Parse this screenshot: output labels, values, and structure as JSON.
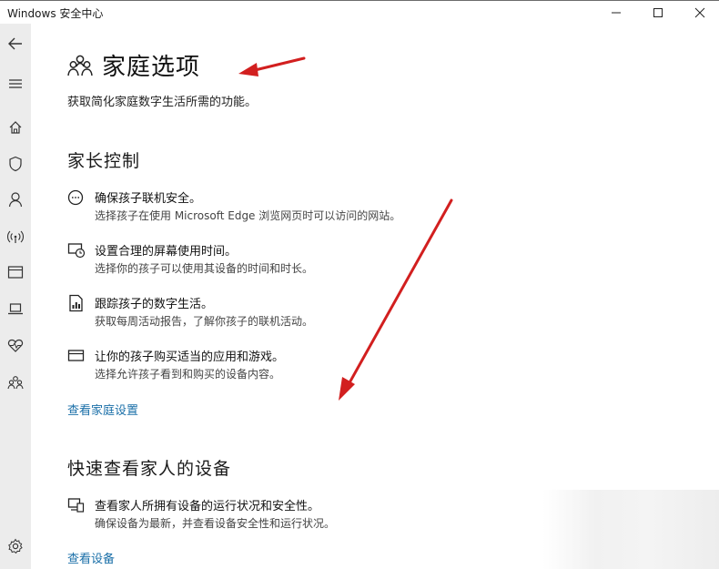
{
  "window": {
    "title": "Windows 安全中心"
  },
  "nav": {
    "items": [
      "back-icon",
      "menu-icon",
      "home-icon",
      "shield-icon",
      "person-icon",
      "wifi-icon",
      "browser-icon",
      "laptop-icon",
      "heart-icon",
      "family-icon"
    ],
    "settings": "gear-icon"
  },
  "page": {
    "title": "家庭选项",
    "subtitle": "获取简化家庭数字生活所需的功能。"
  },
  "parental": {
    "heading": "家长控制",
    "items": [
      {
        "icon": "chat-bubble-icon",
        "title": "确保孩子联机安全。",
        "desc": "选择孩子在使用 Microsoft Edge 浏览网页时可以访问的网站。"
      },
      {
        "icon": "screen-time-icon",
        "title": "设置合理的屏幕使用时间。",
        "desc": "选择你的孩子可以使用其设备的时间和时长。"
      },
      {
        "icon": "report-icon",
        "title": "跟踪孩子的数字生活。",
        "desc": "获取每周活动报告，了解你孩子的联机活动。"
      },
      {
        "icon": "card-icon",
        "title": "让你的孩子购买适当的应用和游戏。",
        "desc": "选择允许孩子看到和购买的设备内容。"
      }
    ],
    "link": "查看家庭设置"
  },
  "devices": {
    "heading": "快速查看家人的设备",
    "item": {
      "icon": "devices-icon",
      "title": "查看家人所拥有设备的运行状况和安全性。",
      "desc": "确保设备为最新，并查看设备安全性和运行状况。"
    },
    "link": "查看设备"
  },
  "colors": {
    "accent": "#1a6fa8",
    "annotation_arrow": "#d21f1f",
    "nav_background": "#ececec"
  }
}
